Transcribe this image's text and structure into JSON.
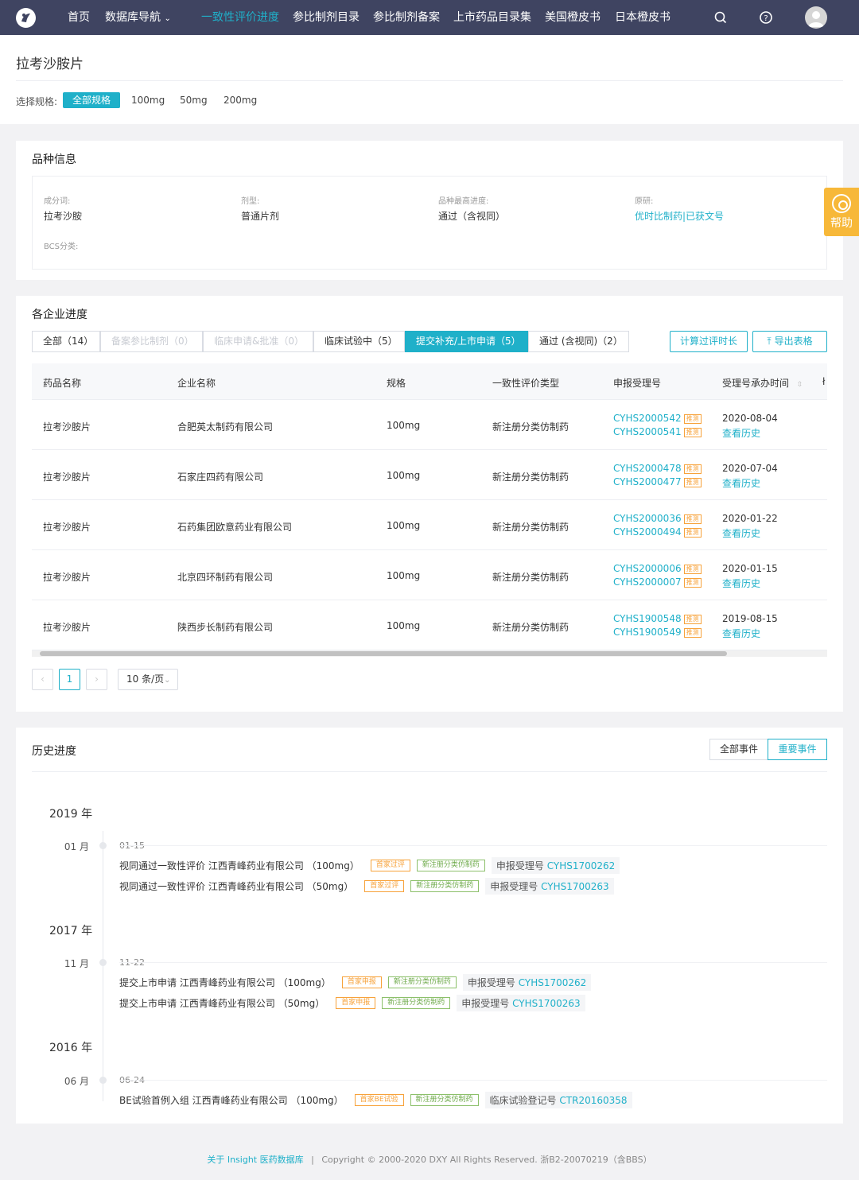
{
  "nav": {
    "items": [
      {
        "label": "首页"
      },
      {
        "label": "数据库导航"
      },
      {
        "label": "一致性评价进度"
      },
      {
        "label": "参比制剂目录"
      },
      {
        "label": "参比制剂备案"
      },
      {
        "label": "上市药品目录集"
      },
      {
        "label": "美国橙皮书"
      },
      {
        "label": "日本橙皮书"
      }
    ],
    "icons": [
      "search-icon",
      "question-icon",
      "user-avatar"
    ]
  },
  "page": {
    "title": "拉考沙胺片",
    "spec_label": "选择规格:",
    "specs": [
      "全部规格",
      "100mg",
      "50mg",
      "200mg"
    ]
  },
  "variety": {
    "title": "品种信息",
    "ingredient_label": "成分词:",
    "ingredient_value": "拉考沙胺",
    "form_label": "剂型:",
    "form_value": "普通片剂",
    "progress_label": "品种最高进度:",
    "progress_value": "通过（含视同）",
    "original_label": "原研:",
    "original_value": "优时比制药|已获文号",
    "bcs_label": "BCS分类:"
  },
  "help": {
    "label": "帮助"
  },
  "progress": {
    "title": "各企业进度",
    "tabs": [
      "全部（14）",
      "备案参比制剂（0）",
      "临床申请&批准（0）",
      "临床试验中（5）",
      "提交补充/上市申请（5）",
      "通过 (含视同)（2）"
    ],
    "btn_calc": "计算过评时长",
    "btn_export": "导出表格",
    "columns": [
      "药品名称",
      "企业名称",
      "规格",
      "一致性评价类型",
      "申报受理号",
      "受理号承办时间"
    ],
    "rows": [
      {
        "drug": "拉考沙胺片",
        "company": "合肥英太制药有限公司",
        "spec": "100mg",
        "type": "新注册分类仿制药",
        "no1": "CYHS2000542",
        "no2": "CYHS2000541",
        "date": "2020-08-04",
        "hist": "查看历史"
      },
      {
        "drug": "拉考沙胺片",
        "company": "石家庄四药有限公司",
        "spec": "100mg",
        "type": "新注册分类仿制药",
        "no1": "CYHS2000478",
        "no2": "CYHS2000477",
        "date": "2020-07-04",
        "hist": "查看历史"
      },
      {
        "drug": "拉考沙胺片",
        "company": "石药集团欧意药业有限公司",
        "spec": "100mg",
        "type": "新注册分类仿制药",
        "no1": "CYHS2000036",
        "no2": "CYHS2000494",
        "date": "2020-01-22",
        "hist": "查看历史"
      },
      {
        "drug": "拉考沙胺片",
        "company": "北京四环制药有限公司",
        "spec": "100mg",
        "type": "新注册分类仿制药",
        "no1": "CYHS2000006",
        "no2": "CYHS2000007",
        "date": "2020-01-15",
        "hist": "查看历史"
      },
      {
        "drug": "拉考沙胺片",
        "company": "陕西步长制药有限公司",
        "spec": "100mg",
        "type": "新注册分类仿制药",
        "no1": "CYHS1900548",
        "no2": "CYHS1900549",
        "date": "2019-08-15",
        "hist": "查看历史"
      }
    ],
    "tag": "推测",
    "pagination": {
      "current": "1",
      "page_size": "10 条/页"
    }
  },
  "history": {
    "title": "历史进度",
    "btn_all": "全部事件",
    "btn_important": "重要事件",
    "years": [
      {
        "year": "2019 年",
        "month": "01 月",
        "day": "01-15",
        "events": [
          {
            "text": "视同通过一致性评价 江西青峰药业有限公司 （100mg）",
            "tag1": "首家过评",
            "tag2": "新注册分类仿制药",
            "label": "申报受理号",
            "value": "CYHS1700262"
          },
          {
            "text": "视同通过一致性评价 江西青峰药业有限公司 （50mg）",
            "tag1": "首家过评",
            "tag2": "新注册分类仿制药",
            "label": "申报受理号",
            "value": "CYHS1700263"
          }
        ]
      },
      {
        "year": "2017 年",
        "month": "11 月",
        "day": "11-22",
        "events": [
          {
            "text": "提交上市申请 江西青峰药业有限公司 （100mg）",
            "tag1": "首家申报",
            "tag2": "新注册分类仿制药",
            "label": "申报受理号",
            "value": "CYHS1700262"
          },
          {
            "text": "提交上市申请 江西青峰药业有限公司 （50mg）",
            "tag1": "首家申报",
            "tag2": "新注册分类仿制药",
            "label": "申报受理号",
            "value": "CYHS1700263"
          }
        ]
      },
      {
        "year": "2016 年",
        "month": "06 月",
        "day": "06-24",
        "events": [
          {
            "text": "BE试验首例入组 江西青峰药业有限公司 （100mg）",
            "tag1": "首家BE试验",
            "tag2": "新注册分类仿制药",
            "label": "临床试验登记号",
            "value": "CTR20160358"
          }
        ]
      }
    ]
  },
  "footer": {
    "link": "关于 Insight 医药数据库",
    "sep": "|",
    "copyright": "Copyright © 2000-2020 DXY All Rights Reserved. 浙B2-20070219（含BBS）"
  },
  "colors": {
    "accent": "#1fb0c9",
    "nav_bg": "#3f4461",
    "tag_orange": "#f7a23a",
    "tag_green": "#8cc06a",
    "help": "#f7b839"
  }
}
